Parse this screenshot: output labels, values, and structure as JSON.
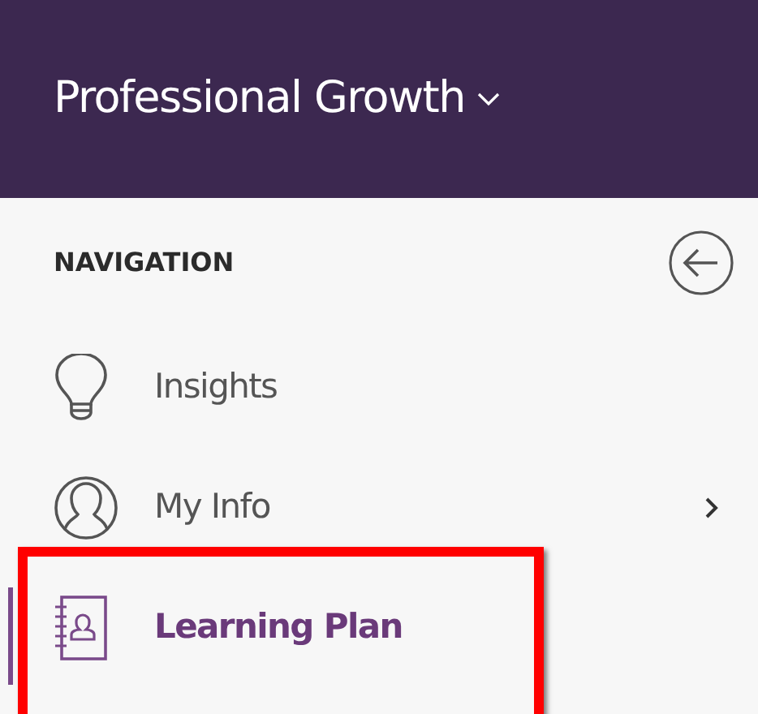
{
  "header": {
    "title": "Professional Growth",
    "dropdown": true
  },
  "sidebar": {
    "heading": "NAVIGATION",
    "items": [
      {
        "label": "Insights",
        "selected": false,
        "has_submenu": false,
        "highlighted": false
      },
      {
        "label": "My Info",
        "selected": false,
        "has_submenu": true,
        "highlighted": false
      },
      {
        "label": "Learning Plan",
        "selected": true,
        "has_submenu": false,
        "highlighted": true
      }
    ]
  }
}
